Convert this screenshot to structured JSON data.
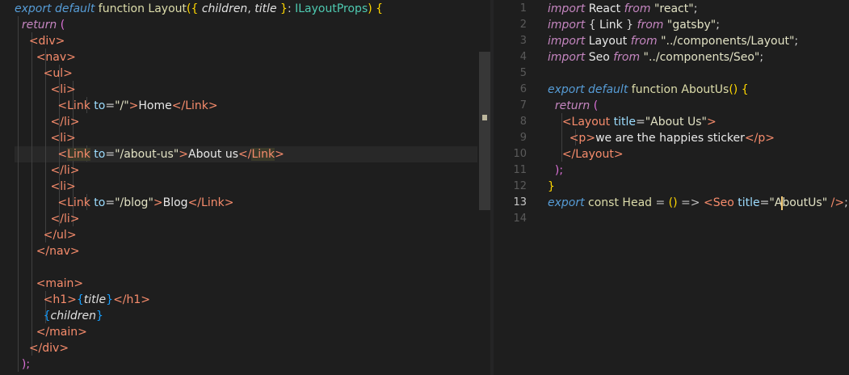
{
  "left_editor": {
    "lines": [
      {
        "tokens": [
          {
            "t": "export default ",
            "c": "t-kw"
          },
          {
            "t": "function ",
            "c": "t-def"
          },
          {
            "t": "Layout",
            "c": "t-def"
          },
          {
            "t": "({ ",
            "c": "t-brkt"
          },
          {
            "t": "children",
            "c": "t-var"
          },
          {
            "t": ", ",
            "c": "t-punct"
          },
          {
            "t": "title",
            "c": "t-var"
          },
          {
            "t": " }",
            "c": "t-brkt"
          },
          {
            "t": ": ",
            "c": "t-punct"
          },
          {
            "t": "ILayoutProps",
            "c": "t-type"
          },
          {
            "t": ") {",
            "c": "t-brkt"
          }
        ]
      },
      {
        "tokens": [
          {
            "t": "  ",
            "c": "t-punct"
          },
          {
            "t": "return",
            "c": "t-ctl"
          },
          {
            "t": " (",
            "c": "t-brkt2"
          }
        ]
      },
      {
        "tokens": [
          {
            "t": "    ",
            "c": "t-punct"
          },
          {
            "t": "<div>",
            "c": "t-tag"
          }
        ]
      },
      {
        "tokens": [
          {
            "t": "      ",
            "c": "t-punct"
          },
          {
            "t": "<nav>",
            "c": "t-tag"
          }
        ]
      },
      {
        "tokens": [
          {
            "t": "        ",
            "c": "t-punct"
          },
          {
            "t": "<ul>",
            "c": "t-tag"
          }
        ]
      },
      {
        "tokens": [
          {
            "t": "          ",
            "c": "t-punct"
          },
          {
            "t": "<li>",
            "c": "t-tag"
          }
        ]
      },
      {
        "tokens": [
          {
            "t": "            ",
            "c": "t-punct"
          },
          {
            "t": "<Link ",
            "c": "t-tag"
          },
          {
            "t": "to",
            "c": "t-attr"
          },
          {
            "t": "=",
            "c": "t-punct"
          },
          {
            "t": "\"/\"",
            "c": "t-str"
          },
          {
            "t": ">",
            "c": "t-tag"
          },
          {
            "t": "Home",
            "c": "t-txt"
          },
          {
            "t": "</Link>",
            "c": "t-tag"
          }
        ]
      },
      {
        "tokens": [
          {
            "t": "          ",
            "c": "t-punct"
          },
          {
            "t": "</li>",
            "c": "t-tag"
          }
        ]
      },
      {
        "tokens": [
          {
            "t": "          ",
            "c": "t-punct"
          },
          {
            "t": "<li>",
            "c": "t-tag"
          }
        ]
      },
      {
        "tokens": [
          {
            "t": "            ",
            "c": "t-punct"
          },
          {
            "t": "<",
            "c": "t-tag"
          },
          {
            "t": "Link",
            "c": "t-tag hl"
          },
          {
            "t": " ",
            "c": "t-punct"
          },
          {
            "t": "to",
            "c": "t-attr"
          },
          {
            "t": "=",
            "c": "t-punct"
          },
          {
            "t": "\"/about-us\"",
            "c": "t-str"
          },
          {
            "t": ">",
            "c": "t-tag"
          },
          {
            "t": "About us",
            "c": "t-txt"
          },
          {
            "t": "</",
            "c": "t-tag"
          },
          {
            "t": "Link",
            "c": "t-tag hl"
          },
          {
            "t": ">",
            "c": "t-tag"
          }
        ]
      },
      {
        "tokens": [
          {
            "t": "          ",
            "c": "t-punct"
          },
          {
            "t": "</li>",
            "c": "t-tag"
          }
        ]
      },
      {
        "tokens": [
          {
            "t": "          ",
            "c": "t-punct"
          },
          {
            "t": "<li>",
            "c": "t-tag"
          }
        ]
      },
      {
        "tokens": [
          {
            "t": "            ",
            "c": "t-punct"
          },
          {
            "t": "<Link ",
            "c": "t-tag"
          },
          {
            "t": "to",
            "c": "t-attr"
          },
          {
            "t": "=",
            "c": "t-punct"
          },
          {
            "t": "\"/blog\"",
            "c": "t-str"
          },
          {
            "t": ">",
            "c": "t-tag"
          },
          {
            "t": "Blog",
            "c": "t-txt"
          },
          {
            "t": "</Link>",
            "c": "t-tag"
          }
        ]
      },
      {
        "tokens": [
          {
            "t": "          ",
            "c": "t-punct"
          },
          {
            "t": "</li>",
            "c": "t-tag"
          }
        ]
      },
      {
        "tokens": [
          {
            "t": "        ",
            "c": "t-punct"
          },
          {
            "t": "</ul>",
            "c": "t-tag"
          }
        ]
      },
      {
        "tokens": [
          {
            "t": "      ",
            "c": "t-punct"
          },
          {
            "t": "</nav>",
            "c": "t-tag"
          }
        ]
      },
      {
        "tokens": []
      },
      {
        "tokens": [
          {
            "t": "      ",
            "c": "t-punct"
          },
          {
            "t": "<main>",
            "c": "t-tag"
          }
        ]
      },
      {
        "tokens": [
          {
            "t": "        ",
            "c": "t-punct"
          },
          {
            "t": "<h1>",
            "c": "t-tag"
          },
          {
            "t": "{",
            "c": "t-brkt3"
          },
          {
            "t": "title",
            "c": "t-var"
          },
          {
            "t": "}",
            "c": "t-brkt3"
          },
          {
            "t": "</h1>",
            "c": "t-tag"
          }
        ]
      },
      {
        "tokens": [
          {
            "t": "        ",
            "c": "t-punct"
          },
          {
            "t": "{",
            "c": "t-brkt3"
          },
          {
            "t": "children",
            "c": "t-var"
          },
          {
            "t": "}",
            "c": "t-brkt3"
          }
        ]
      },
      {
        "tokens": [
          {
            "t": "      ",
            "c": "t-punct"
          },
          {
            "t": "</main>",
            "c": "t-tag"
          }
        ]
      },
      {
        "tokens": [
          {
            "t": "    ",
            "c": "t-punct"
          },
          {
            "t": "</div>",
            "c": "t-tag"
          }
        ]
      },
      {
        "tokens": [
          {
            "t": "  ",
            "c": "t-punct"
          },
          {
            "t": ");",
            "c": "t-brkt2"
          }
        ]
      }
    ]
  },
  "right_editor": {
    "lines": [
      {
        "num": "1",
        "tokens": [
          {
            "t": "import ",
            "c": "t-imp"
          },
          {
            "t": "React ",
            "c": "t-txt"
          },
          {
            "t": "from ",
            "c": "t-imp"
          },
          {
            "t": "\"react\"",
            "c": "t-str"
          },
          {
            "t": ";",
            "c": "t-punct"
          }
        ]
      },
      {
        "num": "2",
        "tokens": [
          {
            "t": "import ",
            "c": "t-imp"
          },
          {
            "t": "{ ",
            "c": "t-punct"
          },
          {
            "t": "Link ",
            "c": "t-txt"
          },
          {
            "t": "} ",
            "c": "t-punct"
          },
          {
            "t": "from ",
            "c": "t-imp"
          },
          {
            "t": "\"gatsby\"",
            "c": "t-str"
          },
          {
            "t": ";",
            "c": "t-punct"
          }
        ]
      },
      {
        "num": "3",
        "tokens": [
          {
            "t": "import ",
            "c": "t-imp"
          },
          {
            "t": "Layout ",
            "c": "t-txt"
          },
          {
            "t": "from ",
            "c": "t-imp"
          },
          {
            "t": "\"../components/Layout\"",
            "c": "t-str"
          },
          {
            "t": ";",
            "c": "t-punct"
          }
        ]
      },
      {
        "num": "4",
        "tokens": [
          {
            "t": "import ",
            "c": "t-imp"
          },
          {
            "t": "Seo ",
            "c": "t-txt"
          },
          {
            "t": "from ",
            "c": "t-imp"
          },
          {
            "t": "\"../components/Seo\"",
            "c": "t-str"
          },
          {
            "t": ";",
            "c": "t-punct"
          }
        ]
      },
      {
        "num": "5",
        "tokens": []
      },
      {
        "num": "6",
        "tokens": [
          {
            "t": "export default ",
            "c": "t-kw"
          },
          {
            "t": "function ",
            "c": "t-def"
          },
          {
            "t": "AboutUs",
            "c": "t-def"
          },
          {
            "t": "() {",
            "c": "t-brkt"
          }
        ]
      },
      {
        "num": "7",
        "tokens": [
          {
            "t": "  ",
            "c": "t-punct"
          },
          {
            "t": "return",
            "c": "t-ctl"
          },
          {
            "t": " (",
            "c": "t-brkt2"
          }
        ]
      },
      {
        "num": "8",
        "tokens": [
          {
            "t": "    ",
            "c": "t-punct"
          },
          {
            "t": "<Layout ",
            "c": "t-tag"
          },
          {
            "t": "title",
            "c": "t-attr"
          },
          {
            "t": "=",
            "c": "t-punct"
          },
          {
            "t": "\"About Us\"",
            "c": "t-str"
          },
          {
            "t": ">",
            "c": "t-tag"
          }
        ]
      },
      {
        "num": "9",
        "tokens": [
          {
            "t": "      ",
            "c": "t-punct"
          },
          {
            "t": "<p>",
            "c": "t-tag"
          },
          {
            "t": "we are the happies sticker",
            "c": "t-txt"
          },
          {
            "t": "</p>",
            "c": "t-tag"
          }
        ]
      },
      {
        "num": "10",
        "tokens": [
          {
            "t": "    ",
            "c": "t-punct"
          },
          {
            "t": "</Layout>",
            "c": "t-tag"
          }
        ]
      },
      {
        "num": "11",
        "tokens": [
          {
            "t": "  ",
            "c": "t-punct"
          },
          {
            "t": ");",
            "c": "t-brkt2"
          }
        ]
      },
      {
        "num": "12",
        "tokens": [
          {
            "t": "}",
            "c": "t-brkt"
          }
        ]
      },
      {
        "num": "13",
        "tokens": [
          {
            "t": "export ",
            "c": "t-kw"
          },
          {
            "t": "const ",
            "c": "t-def"
          },
          {
            "t": "Head ",
            "c": "t-def"
          },
          {
            "t": "= ",
            "c": "t-op"
          },
          {
            "t": "() ",
            "c": "t-brkt"
          },
          {
            "t": "=> ",
            "c": "t-op"
          },
          {
            "t": "<Seo ",
            "c": "t-tag"
          },
          {
            "t": "title",
            "c": "t-attr"
          },
          {
            "t": "=",
            "c": "t-punct"
          },
          {
            "t": "\"A",
            "c": "t-str"
          },
          {
            "t": "|",
            "c": "cursor"
          },
          {
            "t": "boutUs\"",
            "c": "t-str"
          },
          {
            "t": " />",
            "c": "t-tag"
          },
          {
            "t": ";",
            "c": "t-punct"
          }
        ]
      },
      {
        "num": "14",
        "tokens": []
      }
    ]
  }
}
